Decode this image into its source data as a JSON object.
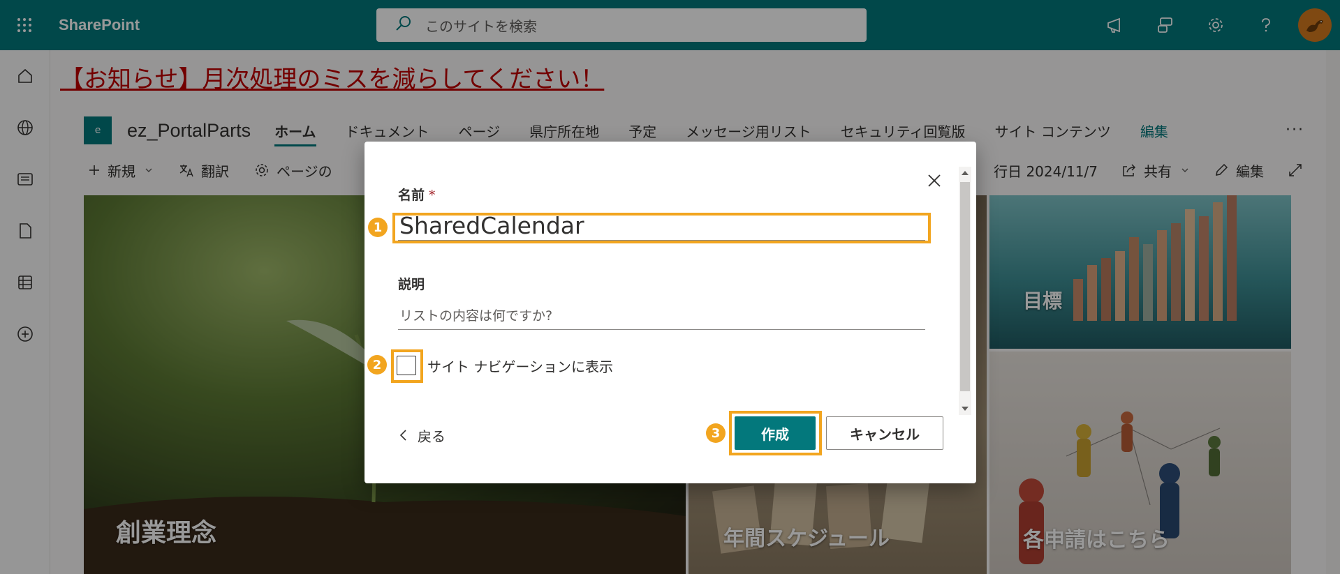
{
  "suitebar": {
    "app_name": "SharePoint",
    "search_placeholder": "このサイトを検索"
  },
  "page": {
    "notice": "【お知らせ】月次処理のミスを減らしてください！",
    "site_logo_letter": "e",
    "site_title": "ez_PortalParts",
    "nav": [
      {
        "label": "ホーム",
        "active": true
      },
      {
        "label": "ドキュメント"
      },
      {
        "label": "ページ"
      },
      {
        "label": "県庁所在地"
      },
      {
        "label": "予定"
      },
      {
        "label": "メッセージ用リスト"
      },
      {
        "label": "セキュリティ回覧版"
      },
      {
        "label": "サイト コンテンツ"
      },
      {
        "label": "編集",
        "edit": true
      }
    ],
    "nav_more": "···",
    "commands": {
      "new": "新規",
      "translate": "翻訳",
      "page_details": "ページの",
      "published": "行日 2024/11/7",
      "share": "共有",
      "edit": "編集"
    },
    "tiles": {
      "mission": "創業理念",
      "goals": "目標",
      "schedule": "年間スケジュール",
      "requests": "各申請はこちら"
    }
  },
  "dialog": {
    "name_label": "名前",
    "required_mark": "*",
    "name_value": "SharedCalendar",
    "desc_label": "説明",
    "desc_placeholder": "リストの内容は何ですか?",
    "nav_checkbox_label": "サイト ナビゲーションに表示",
    "back_label": "戻る",
    "create_label": "作成",
    "cancel_label": "キャンセル"
  },
  "annotations": {
    "badge_1": "1",
    "badge_2": "2",
    "badge_3": "3",
    "highlight_color": "#f2a51f"
  },
  "colors": {
    "brand_teal": "#03787c",
    "notice_red": "#c00000"
  }
}
